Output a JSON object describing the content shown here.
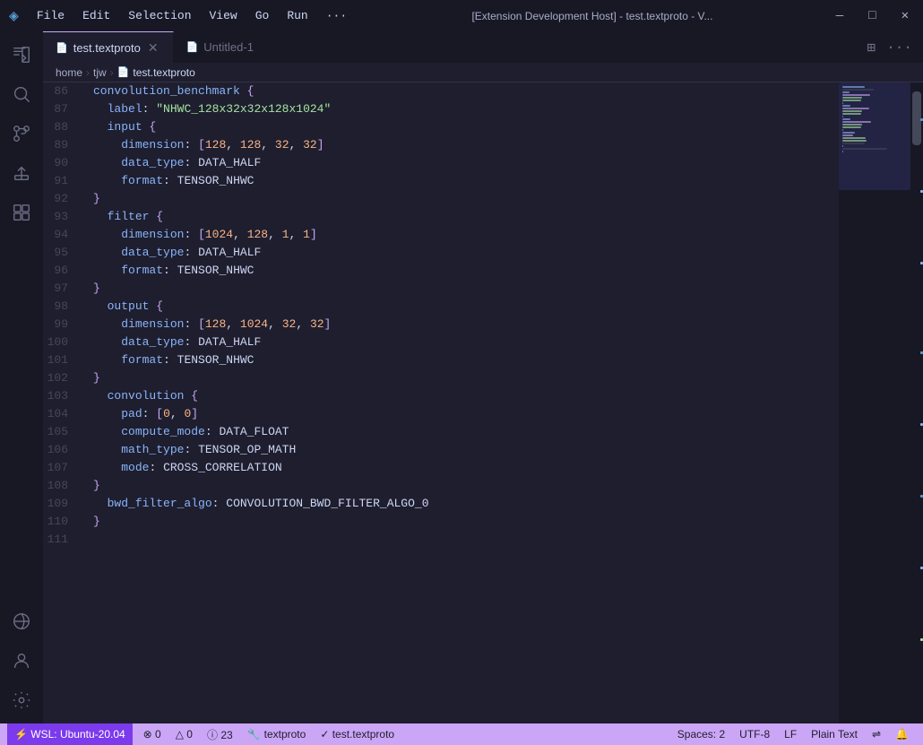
{
  "titleBar": {
    "logo": "◈",
    "menuItems": [
      "File",
      "Edit",
      "Selection",
      "View",
      "Go",
      "Run"
    ],
    "ellipsis": "···",
    "title": "[Extension Development Host] - test.textproto - V...",
    "minimize": "—",
    "maximize": "□",
    "close": "✕"
  },
  "tabs": [
    {
      "id": "test-textproto",
      "label": "test.textproto",
      "icon": "📄",
      "active": true,
      "closeable": true
    },
    {
      "id": "untitled-1",
      "label": "Untitled-1",
      "icon": "📄",
      "active": false,
      "closeable": false
    }
  ],
  "breadcrumb": {
    "items": [
      "home",
      "tjw",
      "test.textproto"
    ]
  },
  "lines": [
    {
      "num": 86,
      "content": "convolution_benchmark {"
    },
    {
      "num": 87,
      "content": "  label: \"NHWC_128x32x32x128x1024\""
    },
    {
      "num": 88,
      "content": "  input {"
    },
    {
      "num": 89,
      "content": "    dimension: [128, 128, 32, 32]"
    },
    {
      "num": 90,
      "content": "    data_type: DATA_HALF"
    },
    {
      "num": 91,
      "content": "    format: TENSOR_NHWC"
    },
    {
      "num": 92,
      "content": "  }"
    },
    {
      "num": 93,
      "content": "  filter {"
    },
    {
      "num": 94,
      "content": "    dimension: [1024, 128, 1, 1]"
    },
    {
      "num": 95,
      "content": "    data_type: DATA_HALF"
    },
    {
      "num": 96,
      "content": "    format: TENSOR_NHWC"
    },
    {
      "num": 97,
      "content": "  }"
    },
    {
      "num": 98,
      "content": "  output {"
    },
    {
      "num": 99,
      "content": "    dimension: [128, 1024, 32, 32]"
    },
    {
      "num": 100,
      "content": "    data_type: DATA_HALF"
    },
    {
      "num": 101,
      "content": "    format: TENSOR_NHWC"
    },
    {
      "num": 102,
      "content": "  }"
    },
    {
      "num": 103,
      "content": "  convolution {"
    },
    {
      "num": 104,
      "content": "    pad: [0, 0]"
    },
    {
      "num": 105,
      "content": "    compute_mode: DATA_FLOAT"
    },
    {
      "num": 106,
      "content": "    math_type: TENSOR_OP_MATH"
    },
    {
      "num": 107,
      "content": "    mode: CROSS_CORRELATION"
    },
    {
      "num": 108,
      "content": "  }"
    },
    {
      "num": 109,
      "content": "  bwd_filter_algo: CONVOLUTION_BWD_FILTER_ALGO_0"
    },
    {
      "num": 110,
      "content": "}"
    },
    {
      "num": 111,
      "content": ""
    }
  ],
  "statusBar": {
    "wsl": "⚡ WSL: Ubuntu-20.04",
    "errors": "⊗ 0",
    "warnings": "△ 0",
    "info": "ⓘ 23",
    "language": "textproto",
    "check": "✓ test.textproto",
    "spaces": "Spaces: 2",
    "encoding": "UTF-8",
    "lineEnding": "LF",
    "mode": "Plain Text",
    "remote": "⇌",
    "bell": "🔔"
  }
}
